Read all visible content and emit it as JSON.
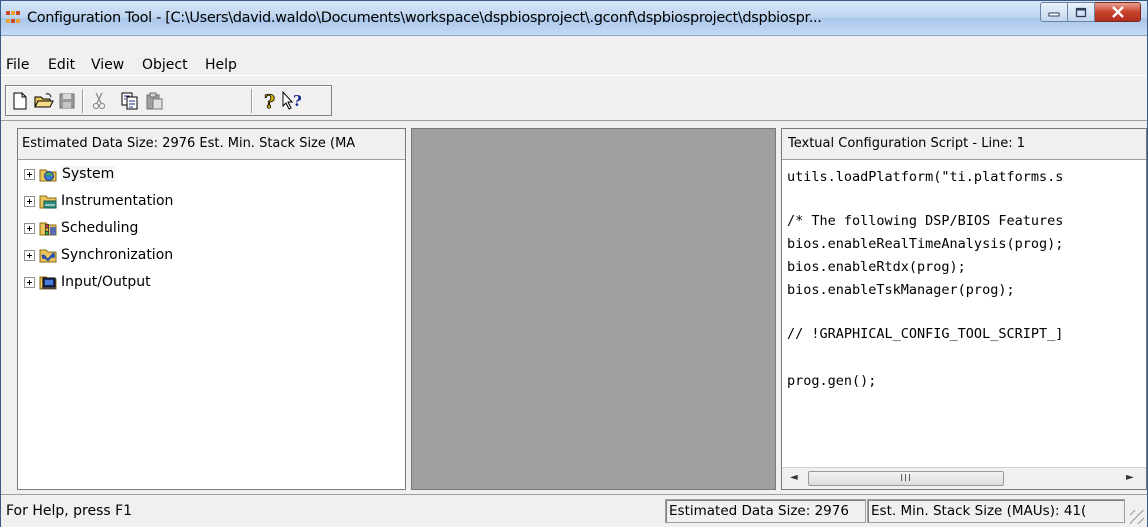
{
  "window": {
    "title": "Configuration Tool - [C:\\Users\\david.waldo\\Documents\\workspace\\dspbiosproject\\.gconf\\dspbiosproject\\dspbiospr...",
    "buttons": {
      "minimize": "minimize-icon",
      "maximize": "maximize-icon",
      "close": "close-icon"
    }
  },
  "menu": {
    "items": [
      {
        "label": "File"
      },
      {
        "label": "Edit"
      },
      {
        "label": "View"
      },
      {
        "label": "Object"
      },
      {
        "label": "Help"
      }
    ]
  },
  "toolbar": {
    "icons": [
      "new-file-icon",
      "open-folder-icon",
      "save-icon",
      "cut-icon",
      "copy-icon",
      "paste-icon",
      "help-icon",
      "context-help-icon"
    ]
  },
  "left_pane": {
    "header": "Estimated Data Size: 2976   Est. Min. Stack Size (MA",
    "tree": [
      {
        "label": "System",
        "icon": "system-icon"
      },
      {
        "label": "Instrumentation",
        "icon": "instrumentation-icon"
      },
      {
        "label": "Scheduling",
        "icon": "scheduling-icon"
      },
      {
        "label": "Synchronization",
        "icon": "synchronization-icon"
      },
      {
        "label": "Input/Output",
        "icon": "input-output-icon"
      }
    ]
  },
  "right_pane": {
    "header": "Textual Configuration Script - Line: 1",
    "script": [
      "utils.loadPlatform(\"ti.platforms.s",
      "",
      "/* The following DSP/BIOS Features",
      "bios.enableRealTimeAnalysis(prog);",
      "bios.enableRtdx(prog);",
      "bios.enableTskManager(prog);",
      "",
      "// !GRAPHICAL_CONFIG_TOOL_SCRIPT_]",
      "",
      "prog.gen();"
    ],
    "scrollbar": {
      "thumb_label": "III",
      "left": "◄",
      "right": "►"
    }
  },
  "status": {
    "help": "For Help, press F1",
    "data_size": "Estimated Data Size: 2976",
    "stack_size": "Est. Min. Stack Size (MAUs): 41("
  }
}
